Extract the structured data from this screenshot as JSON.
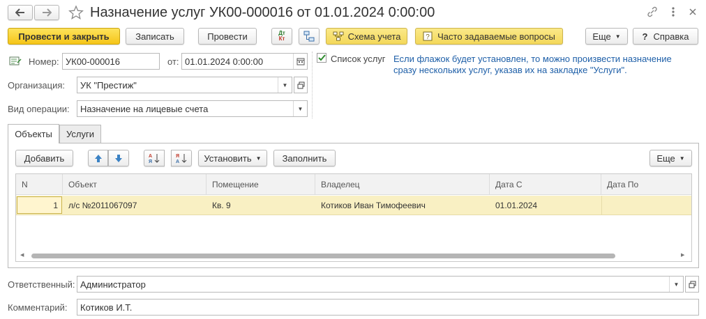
{
  "window": {
    "title": "Назначение услуг УК00-000016 от 01.01.2024 0:00:00"
  },
  "toolbar": {
    "post_close_label": "Провести и закрыть",
    "save_label": "Записать",
    "post_label": "Провести",
    "dtkt_label_top": "Дт",
    "dtkt_label_bottom": "Кт",
    "scheme_label": "Схема учета",
    "faq_label": "Часто задаваемые вопросы",
    "more_label": "Еще",
    "help_label": "Справка",
    "help_icon": "?"
  },
  "form": {
    "number_label": "Номер:",
    "number_value": "УК00-000016",
    "date_label": "от:",
    "date_value": "01.01.2024  0:00:00",
    "services_list_label": "Список услуг",
    "services_list_checked": true,
    "hint_text_line1": "Если флажок будет установлен, то можно произвести назначение",
    "hint_text_line2": "сразу нескольких услуг, указав их на закладке \"Услуги\".",
    "org_label": "Организация:",
    "org_value": "УК \"Престиж\"",
    "op_label": "Вид операции:",
    "op_value": "Назначение на лицевые счета",
    "responsible_label": "Ответственный:",
    "responsible_value": "Администратор",
    "comment_label": "Комментарий:",
    "comment_value": "Котиков И.Т."
  },
  "tabs": [
    {
      "label": "Объекты",
      "active": true
    },
    {
      "label": "Услуги",
      "active": false
    }
  ],
  "table_toolbar": {
    "add_label": "Добавить",
    "set_label": "Установить",
    "fill_label": "Заполнить",
    "more_label": "Еще"
  },
  "table": {
    "columns": [
      "N",
      "Объект",
      "Помещение",
      "Владелец",
      "Дата С",
      "Дата По"
    ],
    "rows": [
      [
        "1",
        "л/с №2011067097",
        "Кв. 9",
        "Котиков Иван Тимофеевич",
        "01.01.2024",
        ""
      ]
    ]
  },
  "colors": {
    "accent_yellow": "#f5c518",
    "hint_blue": "#1e5fa8",
    "row_highlight": "#f9f0c3",
    "arrow_blue": "#3b82c4"
  }
}
